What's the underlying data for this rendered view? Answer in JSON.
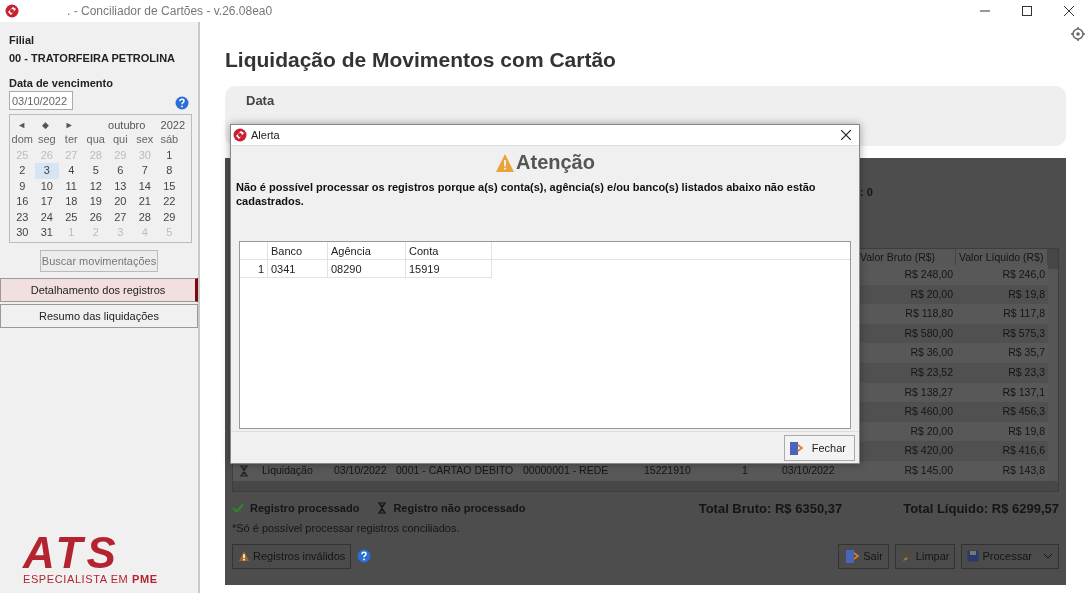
{
  "window": {
    "title": ". - Conciliador de Cartões - v.26.08ea0"
  },
  "sidebar": {
    "filial_label": "Filial",
    "filial_value": "00 - TRATORFEIRA PETROLINA",
    "date_label": "Data de vencimento",
    "date_value": "03/10/2022",
    "calendar": {
      "nav": [
        "◄",
        "◆",
        "►"
      ],
      "month": "outubro",
      "year": "2022",
      "weekdays": [
        "dom",
        "seg",
        "ter",
        "qua",
        "qui",
        "sex",
        "sáb"
      ],
      "weeks": [
        [
          {
            "day": "25",
            "other": true,
            "selected": false
          },
          {
            "day": "26",
            "other": true,
            "selected": false
          },
          {
            "day": "27",
            "other": true,
            "selected": false
          },
          {
            "day": "28",
            "other": true,
            "selected": false
          },
          {
            "day": "29",
            "other": true,
            "selected": false
          },
          {
            "day": "30",
            "other": true,
            "selected": false
          },
          {
            "day": "1",
            "other": false,
            "selected": false
          }
        ],
        [
          {
            "day": "2",
            "other": false,
            "selected": false
          },
          {
            "day": "3",
            "other": false,
            "selected": true
          },
          {
            "day": "4",
            "other": false,
            "selected": false
          },
          {
            "day": "5",
            "other": false,
            "selected": false
          },
          {
            "day": "6",
            "other": false,
            "selected": false
          },
          {
            "day": "7",
            "other": false,
            "selected": false
          },
          {
            "day": "8",
            "other": false,
            "selected": false
          }
        ],
        [
          {
            "day": "9",
            "other": false,
            "selected": false
          },
          {
            "day": "10",
            "other": false,
            "selected": false
          },
          {
            "day": "11",
            "other": false,
            "selected": false
          },
          {
            "day": "12",
            "other": false,
            "selected": false
          },
          {
            "day": "13",
            "other": false,
            "selected": false
          },
          {
            "day": "14",
            "other": false,
            "selected": false
          },
          {
            "day": "15",
            "other": false,
            "selected": false
          }
        ],
        [
          {
            "day": "16",
            "other": false,
            "selected": false
          },
          {
            "day": "17",
            "other": false,
            "selected": false
          },
          {
            "day": "18",
            "other": false,
            "selected": false
          },
          {
            "day": "19",
            "other": false,
            "selected": false
          },
          {
            "day": "20",
            "other": false,
            "selected": false
          },
          {
            "day": "21",
            "other": false,
            "selected": false
          },
          {
            "day": "22",
            "other": false,
            "selected": false
          }
        ],
        [
          {
            "day": "23",
            "other": false,
            "selected": false
          },
          {
            "day": "24",
            "other": false,
            "selected": false
          },
          {
            "day": "25",
            "other": false,
            "selected": false
          },
          {
            "day": "26",
            "other": false,
            "selected": false
          },
          {
            "day": "27",
            "other": false,
            "selected": false
          },
          {
            "day": "28",
            "other": false,
            "selected": false
          },
          {
            "day": "29",
            "other": false,
            "selected": false
          }
        ],
        [
          {
            "day": "30",
            "other": false,
            "selected": false
          },
          {
            "day": "31",
            "other": false,
            "selected": false
          },
          {
            "day": "1",
            "other": true,
            "selected": false
          },
          {
            "day": "2",
            "other": true,
            "selected": false
          },
          {
            "day": "3",
            "other": true,
            "selected": false
          },
          {
            "day": "4",
            "other": true,
            "selected": false
          },
          {
            "day": "5",
            "other": true,
            "selected": false
          }
        ]
      ]
    },
    "search_button": {
      "label": "Buscar movimentações",
      "disabled": true
    },
    "nav": [
      {
        "label": "Detalhamento dos registros",
        "selected": true
      },
      {
        "label": "Resumo das liquidações",
        "selected": false
      }
    ],
    "logo": {
      "mark": "ATS",
      "tagline": "ESPECIALISTA EM **PME**"
    }
  },
  "main": {
    "title": "Liquidação de Movimentos com Cartão",
    "date_card": {
      "label": "Data"
    },
    "summary_fragment": ": 0",
    "grid": {
      "columns": [
        "Valor Bruto (R$)",
        "Valor Líquido (R$)"
      ],
      "rows": [
        {
          "valor_bruto": "R$ 248,00",
          "valor_liquido": "R$ 246,0"
        },
        {
          "valor_bruto": "R$ 20,00",
          "valor_liquido": "R$ 19,8"
        },
        {
          "valor_bruto": "R$ 118,80",
          "valor_liquido": "R$ 117,8"
        },
        {
          "valor_bruto": "R$ 580,00",
          "valor_liquido": "R$ 575,3"
        },
        {
          "valor_bruto": "R$ 36,00",
          "valor_liquido": "R$ 35,7"
        },
        {
          "valor_bruto": "R$ 23,52",
          "valor_liquido": "R$ 23,3"
        },
        {
          "valor_bruto": "R$ 138,27",
          "valor_liquido": "R$ 137,1"
        },
        {
          "valor_bruto": "R$ 460,00",
          "valor_liquido": "R$ 456,3"
        },
        {
          "valor_bruto": "R$ 20,00",
          "valor_liquido": "R$ 19,8"
        },
        {
          "valor_bruto": "R$ 420,00",
          "valor_liquido": "R$ 416,6"
        },
        {
          "processed": false,
          "tipo": "Liquidação",
          "data": "03/10/2022",
          "bandeira": "0001 - CARTAO DEBITO",
          "adquirente": "00000001 - REDE",
          "nsu": "15221910",
          "parcela": "1",
          "vencimento": "03/10/2022",
          "valor_bruto": "R$ 145,00",
          "valor_liquido": "R$ 143,8"
        }
      ]
    },
    "legend": [
      {
        "kind": "check",
        "label": "Registro processado"
      },
      {
        "kind": "hourglass",
        "label": "Registro não processado"
      }
    ],
    "total_bruto": "Total Bruto: R$ 6350,37",
    "total_liquido": "Total Líquido: R$ 6299,57",
    "note": "*Só é possível processar registros conciliados.",
    "invalid_button": "Registros inválidos",
    "actions": [
      {
        "kind": "exit",
        "label": "Sair"
      },
      {
        "kind": "clear",
        "label": "Limpar"
      },
      {
        "kind": "process",
        "label": "Processar"
      }
    ]
  },
  "dialog": {
    "title": "Alerta",
    "heading": "Atenção",
    "message": "Não é possível processar os registros porque a(s) conta(s), agência(s) e/ou banco(s) listados abaixo não estão cadastrados.",
    "columns": [
      "Banco",
      "Agência",
      "Conta"
    ],
    "rows": [
      {
        "index": "1",
        "cells": [
          "0341",
          "08290",
          "15919"
        ]
      }
    ],
    "button": "Fechar"
  }
}
